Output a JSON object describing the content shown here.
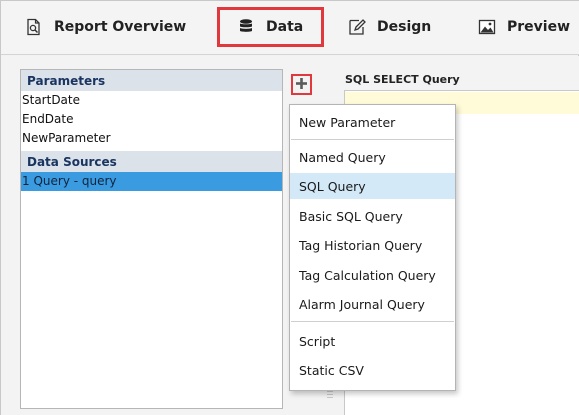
{
  "tabs": [
    {
      "label": "Report Overview",
      "icon": "report-preview-icon"
    },
    {
      "label": "Data",
      "icon": "database-icon"
    },
    {
      "label": "Design",
      "icon": "design-pencil-icon"
    },
    {
      "label": "Preview",
      "icon": "image-preview-icon"
    }
  ],
  "active_tab": "Data",
  "highlight_color": "#e0383c",
  "left_panel": {
    "parameters_header": "Parameters",
    "parameters": [
      "StartDate",
      "EndDate",
      "NewParameter"
    ],
    "datasources_header": "Data Sources",
    "datasources": [
      "1 Query - query"
    ],
    "selected_datasource": "1 Query - query",
    "selection_color": "#3a9be0"
  },
  "add_button": {
    "icon": "plus-icon",
    "label": "+"
  },
  "sql": {
    "label": "SQL SELECT Query"
  },
  "menu": {
    "items": [
      {
        "label": "New Parameter"
      },
      {
        "label": "Named Query"
      },
      {
        "label": "SQL Query"
      },
      {
        "label": "Basic SQL Query"
      },
      {
        "label": "Tag Historian Query"
      },
      {
        "label": "Tag Calculation Query"
      },
      {
        "label": "Alarm Journal Query"
      },
      {
        "label": "Script"
      },
      {
        "label": "Static CSV"
      }
    ],
    "hovered": "SQL Query"
  }
}
